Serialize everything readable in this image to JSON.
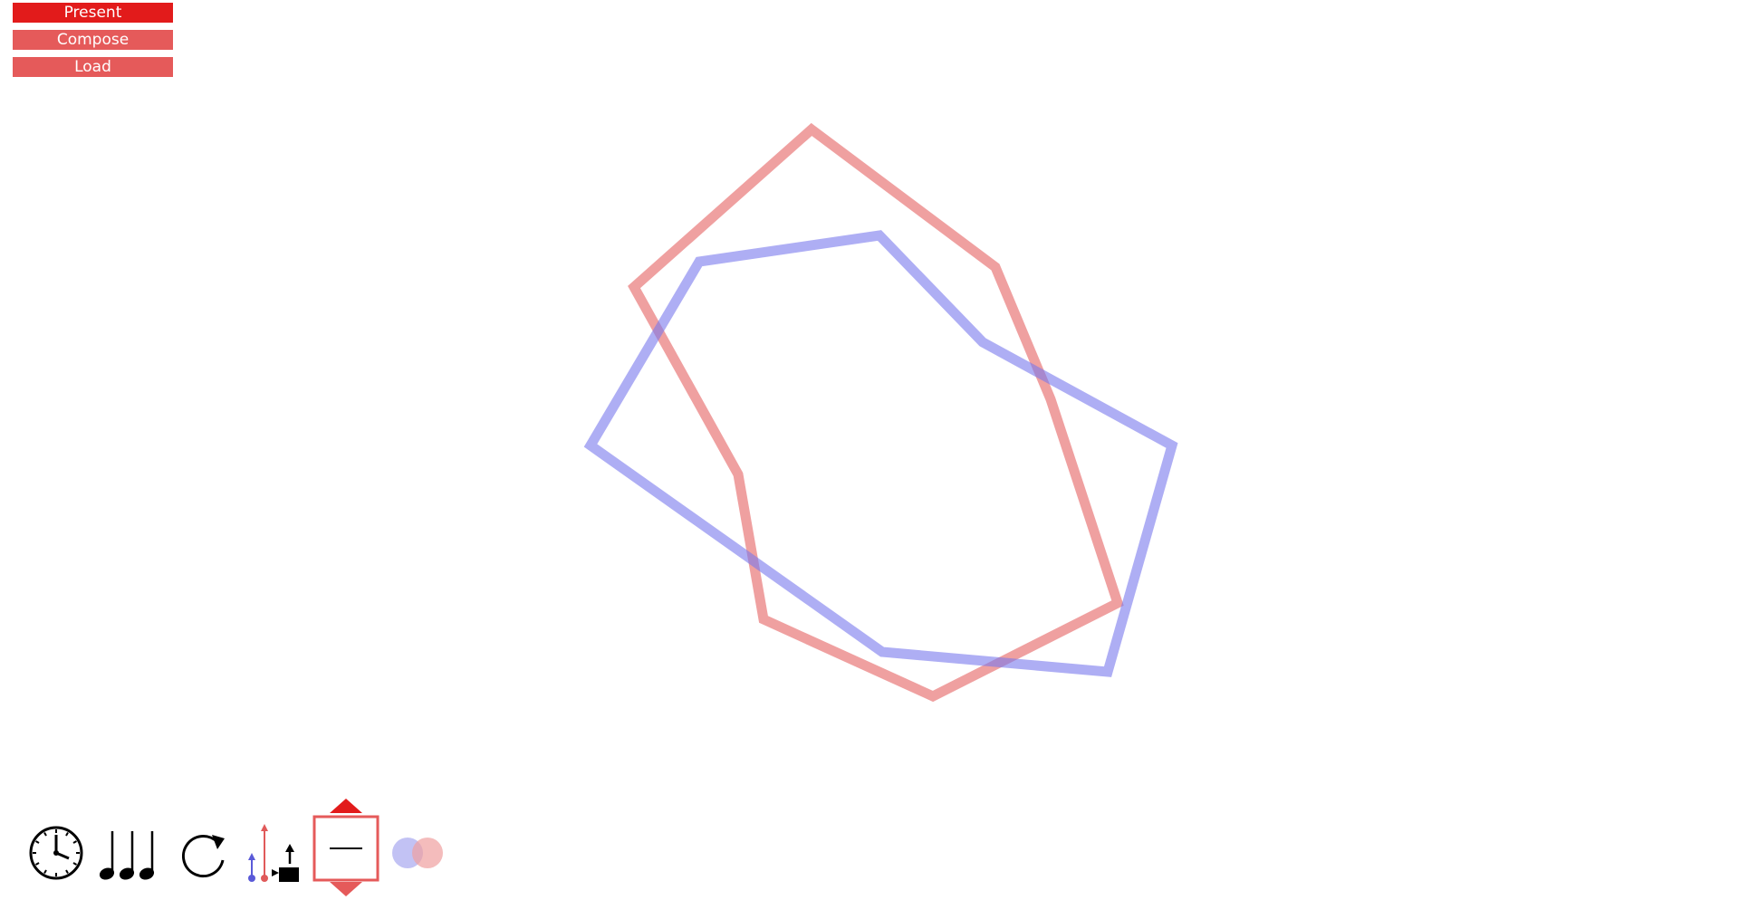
{
  "menu": {
    "present_label": "Present",
    "compose_label": "Compose",
    "load_label": "Load"
  },
  "colors": {
    "primary_button": "#e21b1b",
    "secondary_button": "#e55a5a",
    "red_polygon": "#e87878",
    "blue_polygon": "#7878ec"
  },
  "toolbar": {
    "tools": [
      "clock-icon",
      "notes-icon",
      "refresh-icon",
      "voices-camera-icon",
      "shape-stepper",
      "overlap-circles-icon"
    ]
  }
}
